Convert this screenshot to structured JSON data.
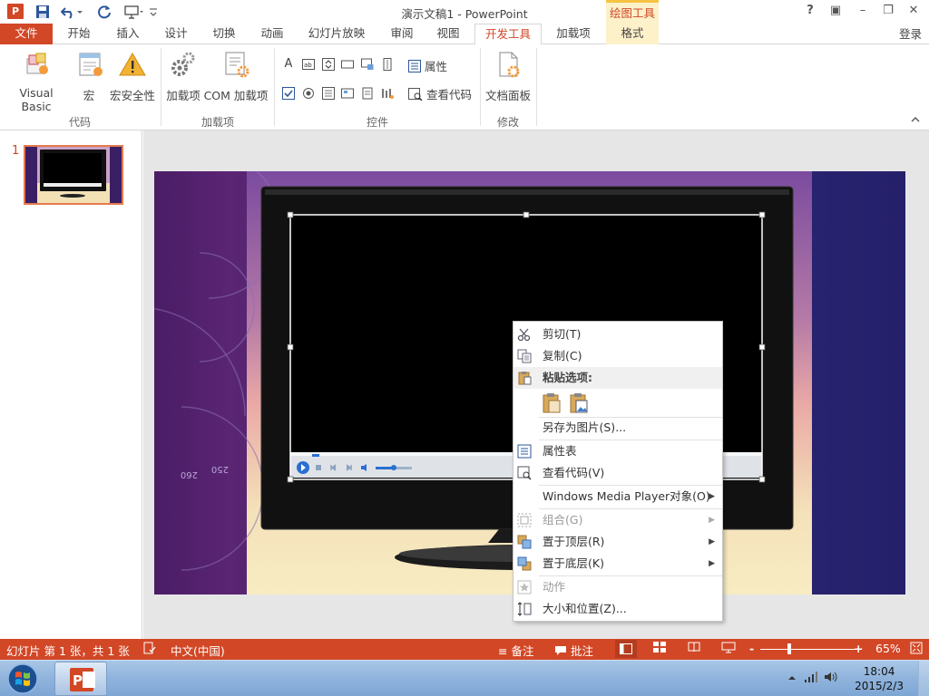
{
  "titlebar": {
    "app_icon": "P",
    "title": "演示文稿1 - PowerPoint",
    "tool_context": "绘图工具",
    "help": "?",
    "restore_ribbon": "▣",
    "minimize": "–",
    "restore": "❐",
    "close": "✕",
    "qat": {
      "save_icon": "save-icon",
      "undo_icon": "undo-icon",
      "redo_icon": "redo-icon",
      "present_icon": "present-icon",
      "customize_icon": "customize-icon"
    }
  },
  "tabs": [
    {
      "label": "文件"
    },
    {
      "label": "开始"
    },
    {
      "label": "插入"
    },
    {
      "label": "设计"
    },
    {
      "label": "切换"
    },
    {
      "label": "动画"
    },
    {
      "label": "幻灯片放映"
    },
    {
      "label": "审阅"
    },
    {
      "label": "视图"
    },
    {
      "label": "开发工具"
    },
    {
      "label": "加载项"
    },
    {
      "label": "格式"
    }
  ],
  "login": "登录",
  "ribbon": {
    "code_group": {
      "label": "代码",
      "visual_basic": "Visual Basic",
      "macro": "宏",
      "macro_security": "宏安全性"
    },
    "addins_group": {
      "label": "加载项",
      "addins": "加载项",
      "com_addins": "COM 加载项"
    },
    "controls_group": {
      "label": "控件",
      "properties": "属性",
      "view_code": "查看代码"
    },
    "modify_group": {
      "label": "修改",
      "doc_panel": "文档面板"
    }
  },
  "thumbs": {
    "slide_number": "1"
  },
  "context_menu": {
    "cut": "剪切(T)",
    "copy": "复制(C)",
    "paste_options": "粘贴选项:",
    "save_as_picture": "另存为图片(S)...",
    "property_sheet": "属性表",
    "view_code": "查看代码(V)",
    "wmp_object": "Windows Media Player对象(O)",
    "group": "组合(G)",
    "bring_front": "置于顶层(R)",
    "send_back": "置于底层(K)",
    "action": "动作",
    "size_position": "大小和位置(Z)..."
  },
  "statusbar": {
    "slide_info": "幻灯片 第 1 张，共 1 张",
    "language": "中文(中国)",
    "notes": "备注",
    "comments": "批注",
    "zoom_value": 65,
    "zoom_label": "65%",
    "zoom_minus": "-",
    "zoom_plus": "+"
  },
  "taskbar": {
    "time": "18:04",
    "date": "2015/2/3"
  },
  "colors": {
    "accent": "#d24726",
    "tool_context_bg": "#fdf1c9",
    "tool_context_text": "#d24726"
  }
}
